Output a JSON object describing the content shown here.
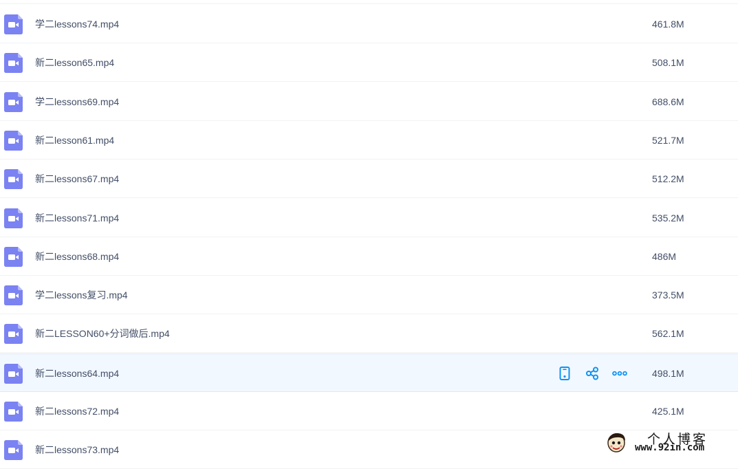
{
  "colors": {
    "file_icon": "#7b82f2",
    "action_icon": "#0d93f2",
    "text": "#424e67",
    "hover_row": "#f2f8ff"
  },
  "files": [
    {
      "name": "学二lessons74.mp4",
      "size": "461.8M",
      "icon": "video-file-icon"
    },
    {
      "name": "新二lesson65.mp4",
      "size": "508.1M",
      "icon": "video-file-icon"
    },
    {
      "name": "学二lessons69.mp4",
      "size": "688.6M",
      "icon": "video-file-icon"
    },
    {
      "name": "新二lesson61.mp4",
      "size": "521.7M",
      "icon": "video-file-icon"
    },
    {
      "name": "新二lessons67.mp4",
      "size": "512.2M",
      "icon": "video-file-icon"
    },
    {
      "name": "新二lessons71.mp4",
      "size": "535.2M",
      "icon": "video-file-icon"
    },
    {
      "name": "新二lessons68.mp4",
      "size": "486M",
      "icon": "video-file-icon"
    },
    {
      "name": "学二lessons复习.mp4",
      "size": "373.5M",
      "icon": "video-file-icon"
    },
    {
      "name": "新二LESSON60+分词做后.mp4",
      "size": "562.1M",
      "icon": "video-file-icon"
    },
    {
      "name": "新二lessons64.mp4",
      "size": "498.1M",
      "icon": "video-file-icon",
      "hovered": true
    },
    {
      "name": "新二lessons72.mp4",
      "size": "425.1M",
      "icon": "video-file-icon"
    },
    {
      "name": "新二lessons73.mp4",
      "size": "",
      "icon": "video-file-icon"
    }
  ],
  "row_actions": [
    {
      "name": "send-to-phone",
      "icon": "phone-icon"
    },
    {
      "name": "share",
      "icon": "share-icon"
    },
    {
      "name": "more",
      "icon": "more-icon"
    }
  ],
  "watermark": {
    "title": "个人博客",
    "url": "www.92in.com"
  }
}
